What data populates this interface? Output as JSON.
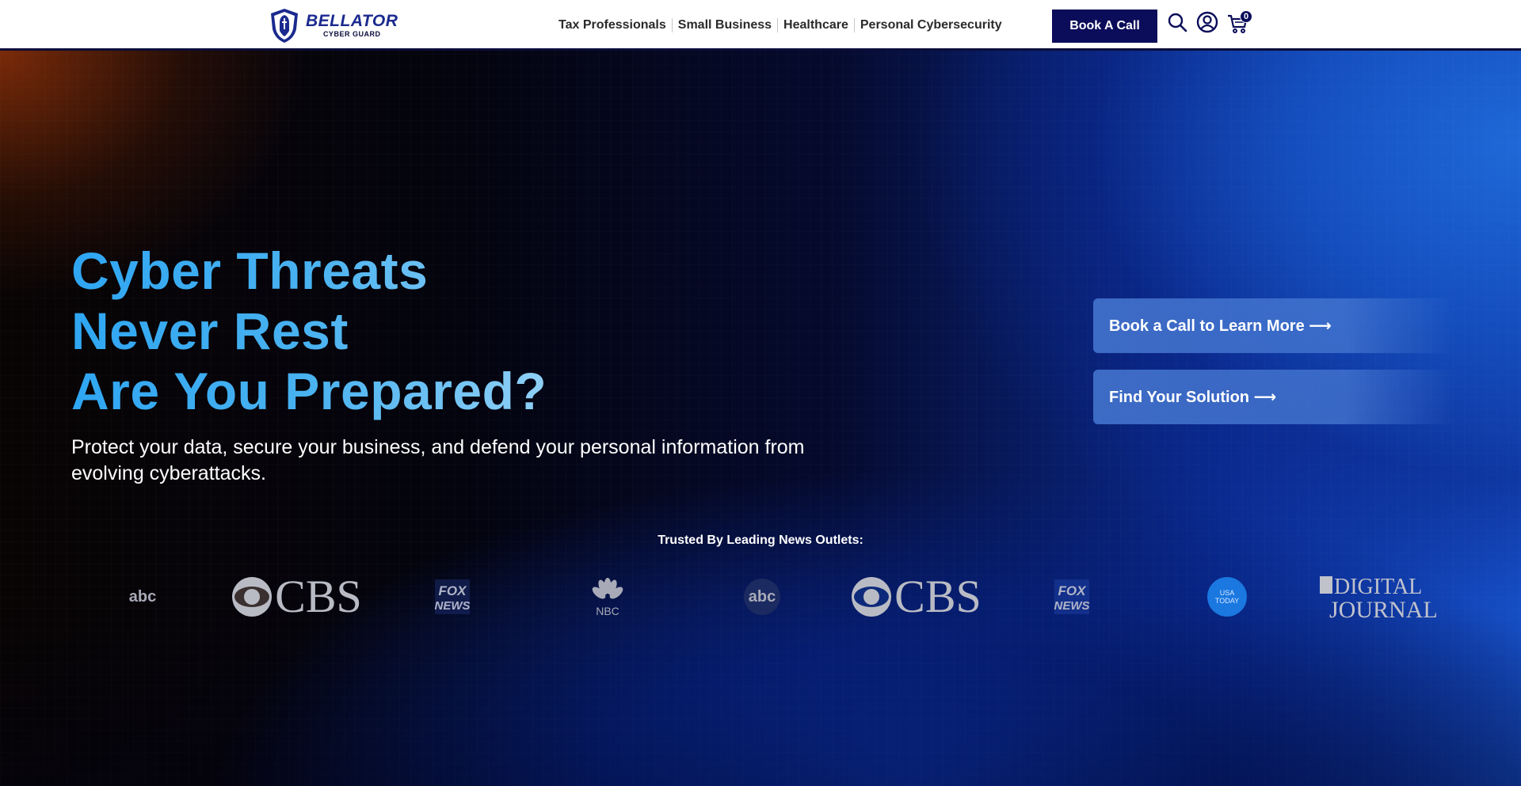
{
  "header": {
    "logo": {
      "name": "BELLATOR",
      "subtitle": "CYBER GUARD"
    },
    "nav": [
      {
        "label": "Tax Professionals"
      },
      {
        "label": "Small Business"
      },
      {
        "label": "Healthcare"
      },
      {
        "label": "Personal Cybersecurity"
      }
    ],
    "cta_label": "Book A Call",
    "icons": [
      "search-icon",
      "user-account-icon",
      "cart-icon"
    ],
    "cart_count": "0"
  },
  "hero": {
    "headline": [
      "Cyber Threats",
      "Never Rest",
      "Are You Prepared?"
    ],
    "subtext": "Protect your data, secure your business, and defend your personal information from evolving cyberattacks.",
    "buttons": [
      {
        "label": "Book a Call to Learn More ⟶"
      },
      {
        "label": "Find Your Solution ⟶"
      }
    ],
    "trusted_label": "Trusted By Leading News Outlets:",
    "outlets": [
      {
        "name": "abc",
        "brand_text": "abc"
      },
      {
        "name": "CBS",
        "brand_text": "CBS"
      },
      {
        "name": "FOX NEWS",
        "brand_text": "FOX NEWS"
      },
      {
        "name": "NBC",
        "brand_text": "NBC"
      },
      {
        "name": "abc",
        "brand_text": "abc"
      },
      {
        "name": "CBS",
        "brand_text": "CBS"
      },
      {
        "name": "FOX NEWS",
        "brand_text": "FOX NEWS"
      },
      {
        "name": "USA TODAY",
        "brand_text": "USA TODAY"
      },
      {
        "name": "DIGITAL JOURNAL",
        "brand_text": "DIGITAL JOURNAL"
      }
    ]
  },
  "colors": {
    "brand_navy": "#0b0d5a",
    "headline_blue": "#2fa6f2",
    "hero_blue": "#1650c8",
    "accent_orange": "#a0370a"
  }
}
